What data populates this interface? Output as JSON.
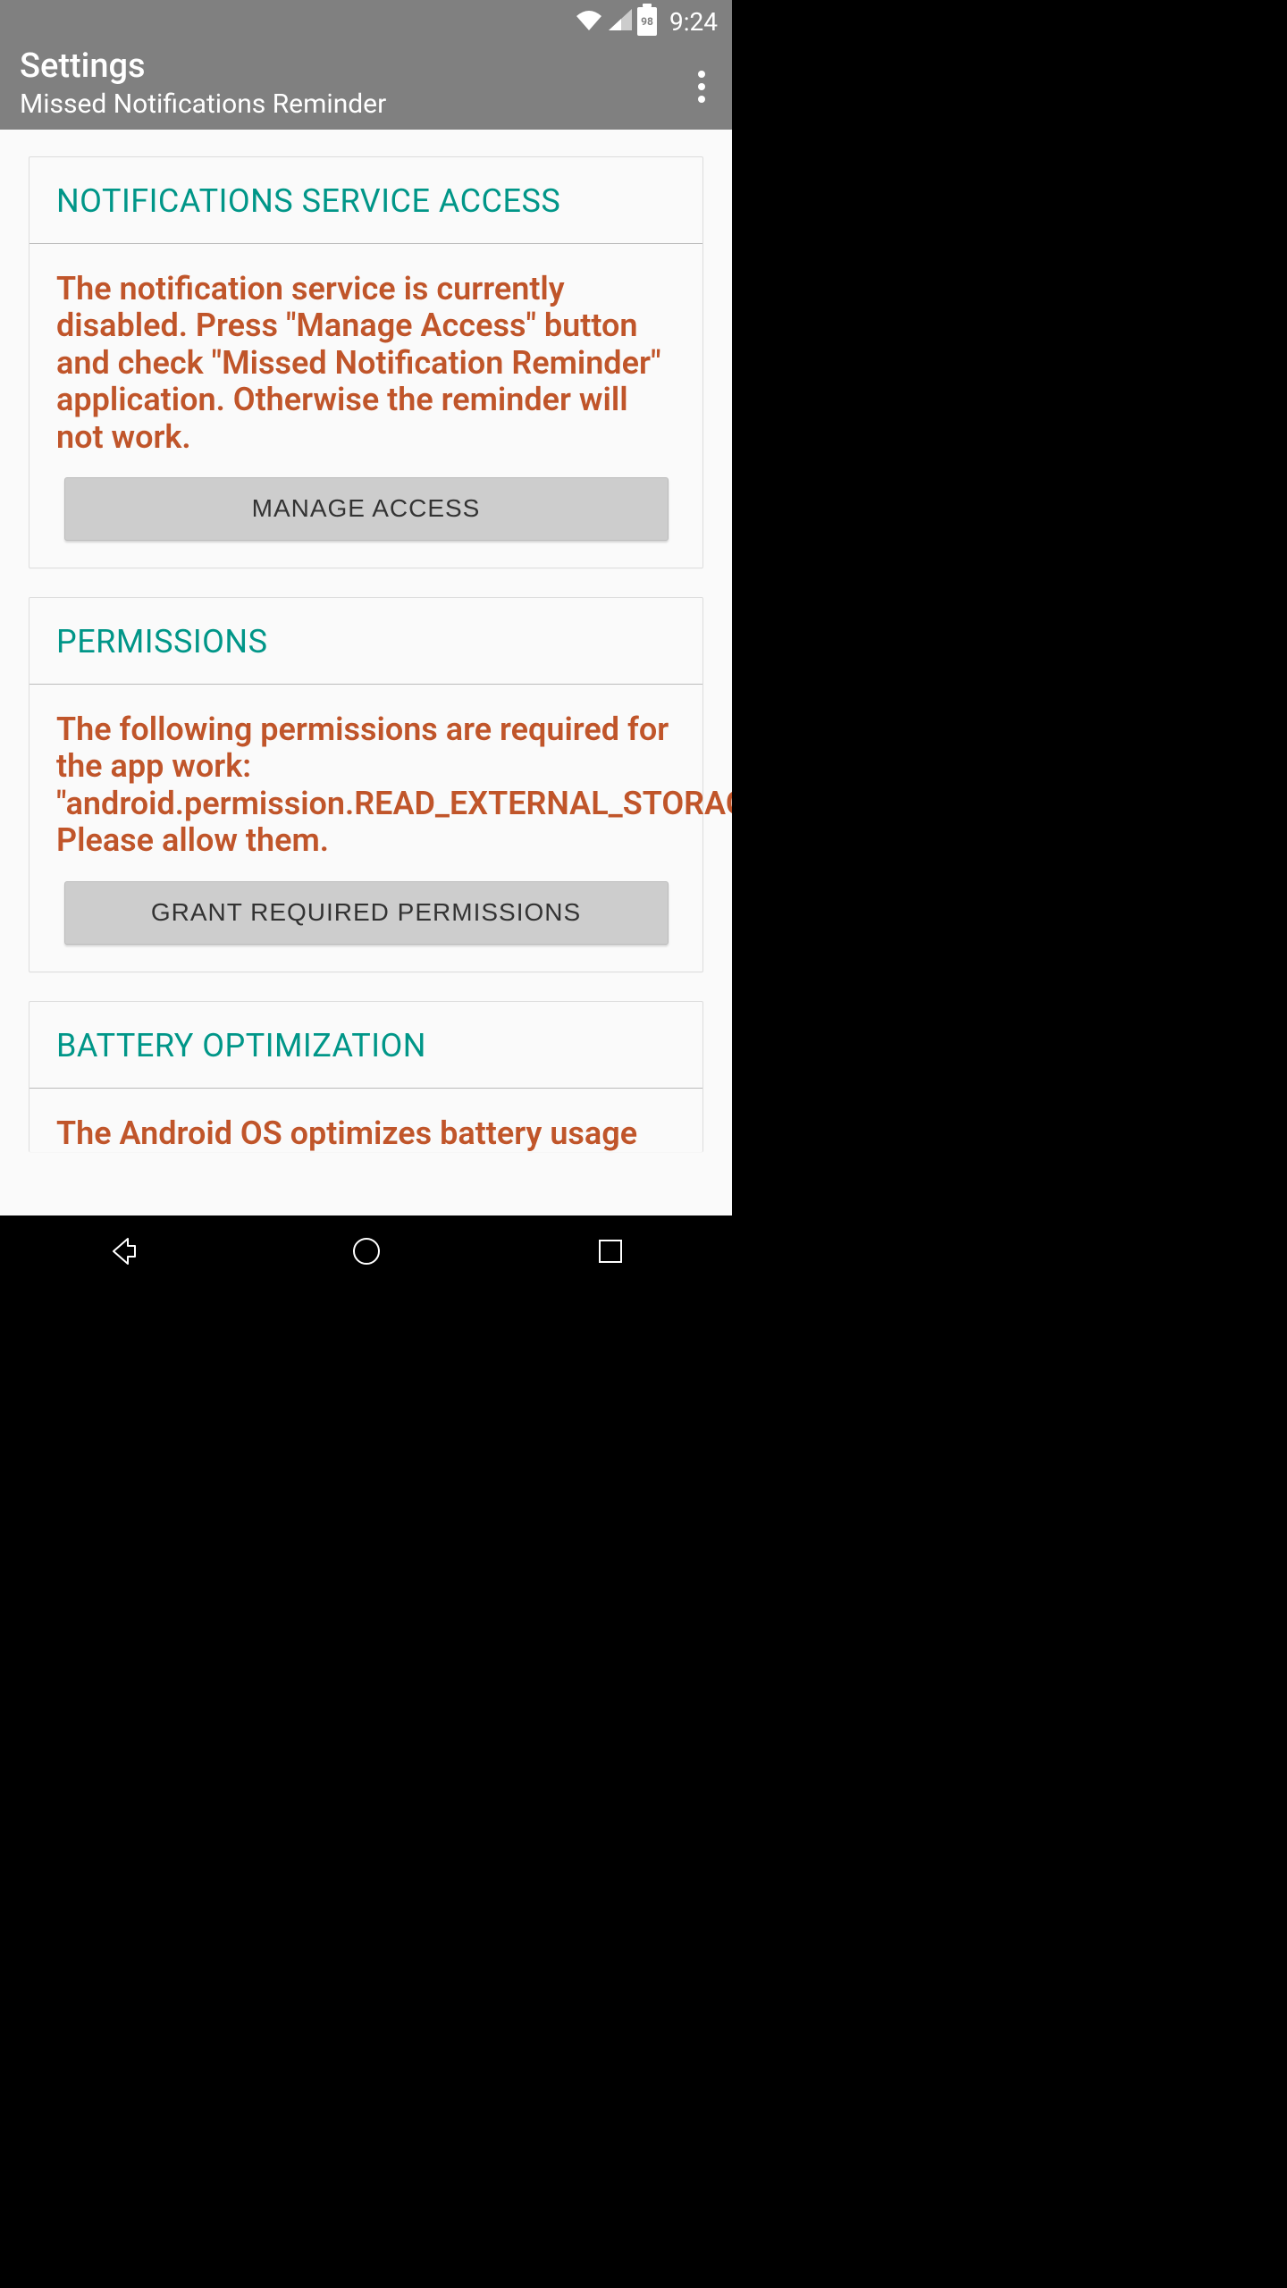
{
  "status_bar": {
    "battery_level": "98",
    "time": "9:24"
  },
  "app_bar": {
    "title": "Settings",
    "subtitle": "Missed Notifications Reminder"
  },
  "sections": {
    "notifications": {
      "header": "NOTIFICATIONS SERVICE ACCESS",
      "body": "The notification service is currently disabled. Press \"Manage Access\" button and check \"Missed Notification Reminder\" application. Otherwise the reminder will not work.",
      "button": "MANAGE ACCESS"
    },
    "permissions": {
      "header": "PERMISSIONS",
      "body": "The following permissions are required for the app work: \"android.permission.READ_EXTERNAL_STORAGE\". Please allow them.",
      "button": "GRANT REQUIRED PERMISSIONS"
    },
    "battery": {
      "header": "BATTERY OPTIMIZATION",
      "body": "The Android OS optimizes battery usage"
    }
  },
  "colors": {
    "accent": "#009688",
    "warning": "#c0552a",
    "appbar": "#808080"
  }
}
